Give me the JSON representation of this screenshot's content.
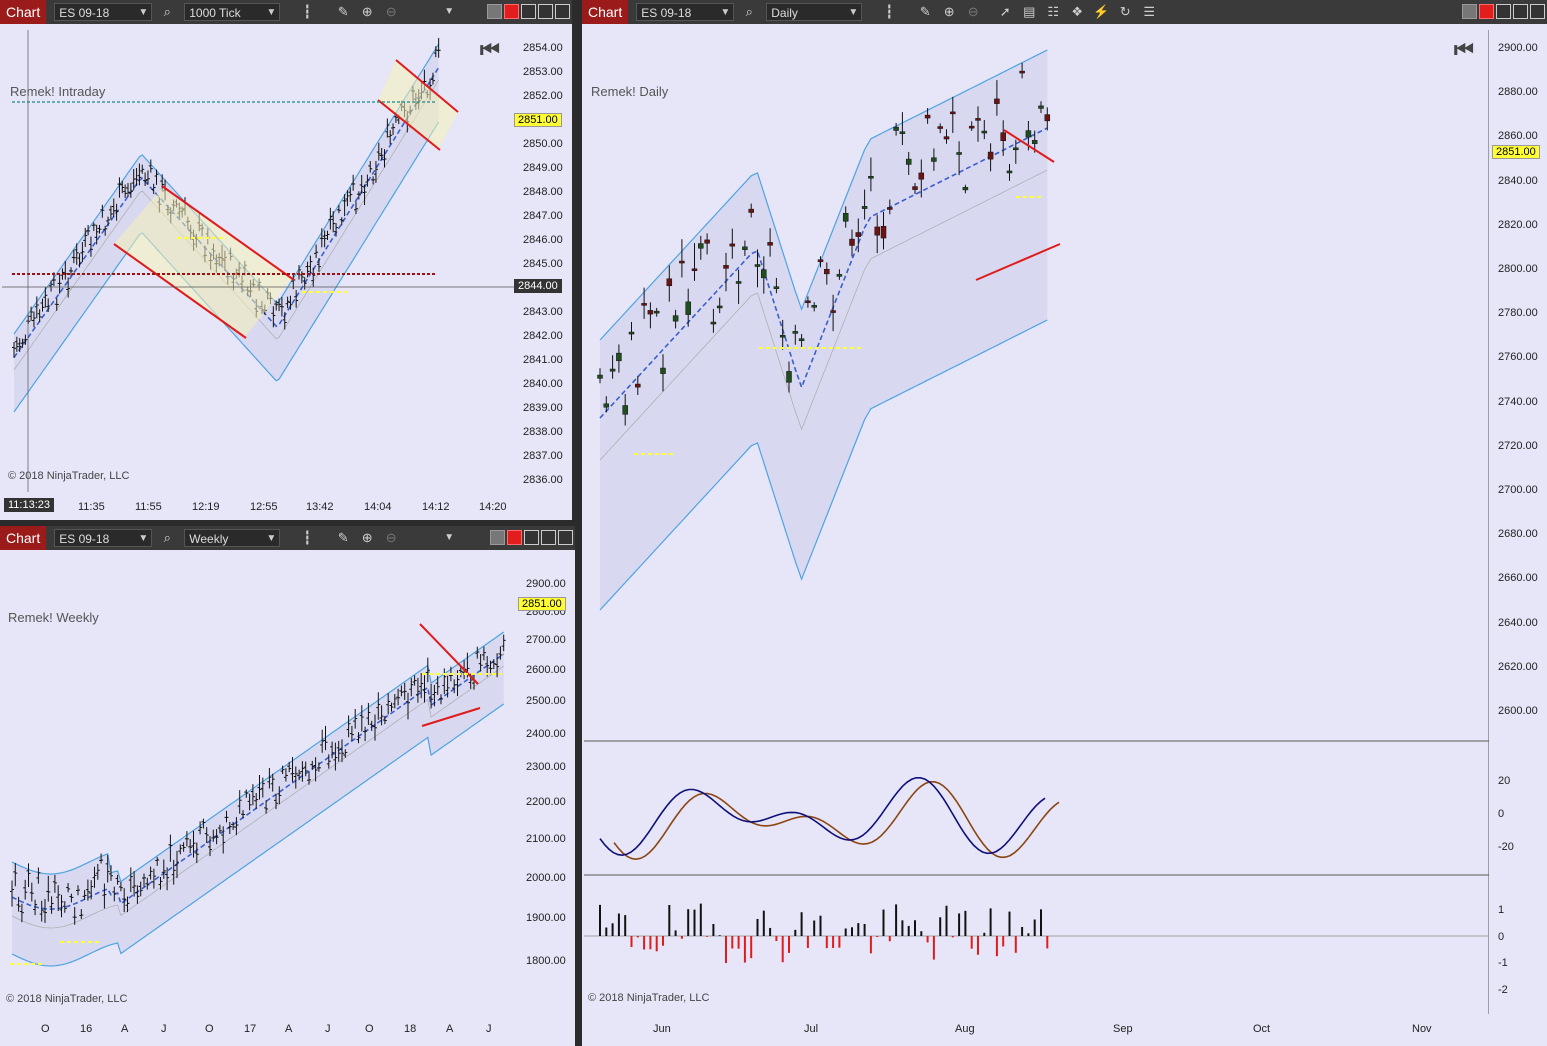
{
  "windows": {
    "intraday": {
      "tab": "Chart",
      "instrument": "ES 09-18",
      "interval": "1000 Tick",
      "label": "Remek! Intraday",
      "copyright": "© 2018 NinjaTrader, LLC",
      "last_price": "2851.00",
      "cursor_price": "2844.00",
      "cursor_time": "11:13:23",
      "y_ticks": [
        "2854.00",
        "2853.00",
        "2852.00",
        "2851.00",
        "2850.00",
        "2849.00",
        "2848.00",
        "2847.00",
        "2846.00",
        "2845.00",
        "2844.00",
        "2843.00",
        "2842.00",
        "2841.00",
        "2840.00",
        "2839.00",
        "2838.00",
        "2837.00",
        "2836.00"
      ],
      "x_ticks": [
        "11:35",
        "11:55",
        "12:19",
        "12:55",
        "13:42",
        "14:04",
        "14:12",
        "14:20"
      ]
    },
    "weekly": {
      "tab": "Chart",
      "instrument": "ES 09-18",
      "interval": "Weekly",
      "label": "Remek! Weekly",
      "copyright": "© 2018 NinjaTrader, LLC",
      "last_price": "2851.00",
      "y_ticks": [
        "2900.00",
        "2800.00",
        "2700.00",
        "2600.00",
        "2500.00",
        "2400.00",
        "2300.00",
        "2200.00",
        "2100.00",
        "2000.00",
        "1900.00",
        "1800.00"
      ],
      "x_ticks": [
        "O",
        "16",
        "A",
        "J",
        "O",
        "17",
        "A",
        "J",
        "O",
        "18",
        "A",
        "J"
      ]
    },
    "daily": {
      "tab": "Chart",
      "instrument": "ES 09-18",
      "interval": "Daily",
      "label": "Remek! Daily",
      "copyright": "© 2018 NinjaTrader, LLC",
      "last_price": "2851.00",
      "y_ticks": [
        "2900.00",
        "2880.00",
        "2860.00",
        "2840.00",
        "2820.00",
        "2800.00",
        "2780.00",
        "2760.00",
        "2740.00",
        "2720.00",
        "2700.00",
        "2680.00",
        "2660.00",
        "2640.00",
        "2620.00",
        "2600.00"
      ],
      "osc_ticks": [
        "20",
        "0",
        "-20"
      ],
      "hist_ticks": [
        "1",
        "0",
        "-1",
        "-2"
      ],
      "x_ticks": [
        "Jun",
        "Jul",
        "Aug",
        "Sep",
        "Oct",
        "Nov"
      ]
    }
  },
  "icons": [
    "search-icon",
    "bar-style-icon",
    "pencil-icon",
    "zoom-in-icon",
    "zoom-out-icon",
    "pointer-icon",
    "data-box-icon",
    "properties-icon",
    "templates-icon",
    "strategy-icon",
    "refresh-icon",
    "list-icon",
    "home-icon"
  ],
  "colors": {
    "accent_red": "#9b1b1b",
    "price_tag": "#ffff33",
    "band": "#4fa3e0",
    "mid_line": "#3a5fcd",
    "bull": "#1e4d1e",
    "bear": "#6b1414"
  }
}
